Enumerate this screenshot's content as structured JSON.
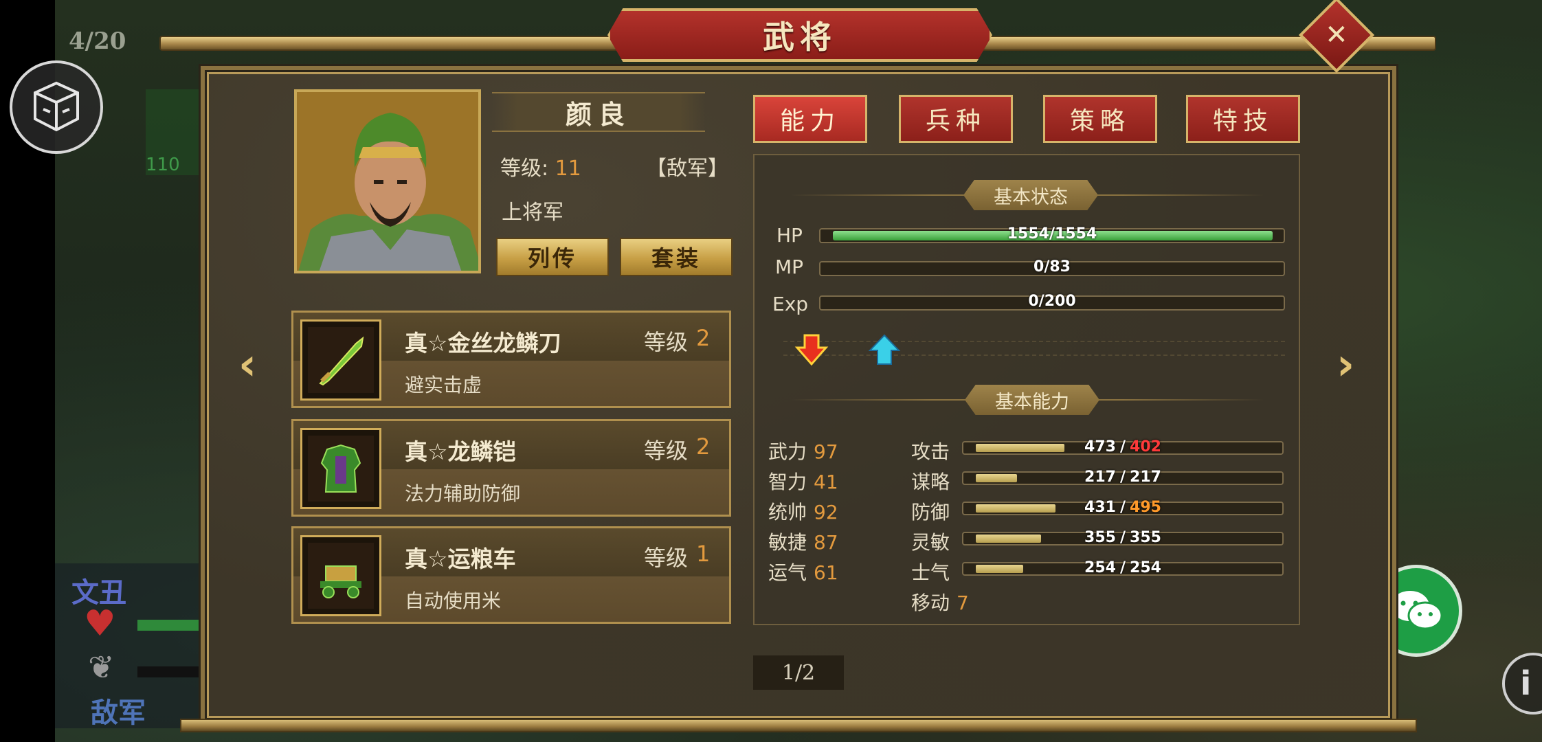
{
  "hud": {
    "turn": "4/20",
    "ally_unit_value": "110",
    "enemy_unit": {
      "name": "文丑",
      "side": "敌军"
    }
  },
  "dialog": {
    "title": "武将",
    "close_icon": "close-x-icon"
  },
  "general": {
    "name": "颜良",
    "level_label": "等级:",
    "level": "11",
    "faction": "【敌军】",
    "rank": "上将军",
    "buttons": {
      "bio": "列传",
      "set": "套装"
    }
  },
  "equipment": [
    {
      "name": "真☆金丝龙鳞刀",
      "level_label": "等级",
      "level": "2",
      "desc": "避实击虚",
      "icon": "sword-icon"
    },
    {
      "name": "真☆龙鳞铠",
      "level_label": "等级",
      "level": "2",
      "desc": "法力辅助防御",
      "icon": "armor-icon"
    },
    {
      "name": "真☆运粮车",
      "level_label": "等级",
      "level": "1",
      "desc": "自动使用米",
      "icon": "supply-cart-icon"
    }
  ],
  "tabs": [
    "能力",
    "兵种",
    "策略",
    "特技"
  ],
  "active_tab": "能力",
  "basic_status": {
    "title": "基本状态",
    "hp": {
      "label": "HP",
      "text": "1554/1554",
      "current": 1554,
      "max": 1554,
      "color": "#4fb84f"
    },
    "mp": {
      "label": "MP",
      "text": "0/83",
      "current": 0,
      "max": 83
    },
    "exp": {
      "label": "Exp",
      "text": "0/200",
      "current": 0,
      "max": 200
    },
    "status_icons": [
      "stat-down-arrow-icon",
      "stat-up-arrow-icon"
    ]
  },
  "basic_ability": {
    "title": "基本能力",
    "attributes": [
      {
        "label": "武力",
        "value": "97"
      },
      {
        "label": "智力",
        "value": "41"
      },
      {
        "label": "统帅",
        "value": "92"
      },
      {
        "label": "敏捷",
        "value": "87"
      },
      {
        "label": "运气",
        "value": "61"
      }
    ],
    "derived": [
      {
        "label": "攻击",
        "current": "473",
        "base": "402",
        "base_color": "red",
        "fill": 0.3
      },
      {
        "label": "谋略",
        "current": "217",
        "base": "217",
        "base_color": "white",
        "fill": 0.14
      },
      {
        "label": "防御",
        "current": "431",
        "base": "495",
        "base_color": "orange",
        "fill": 0.27
      },
      {
        "label": "灵敏",
        "current": "355",
        "base": "355",
        "base_color": "white",
        "fill": 0.22
      },
      {
        "label": "士气",
        "current": "254",
        "base": "254",
        "base_color": "white",
        "fill": 0.16
      }
    ],
    "move_label": "移动",
    "move_value": "7"
  },
  "pagination": "1/2"
}
